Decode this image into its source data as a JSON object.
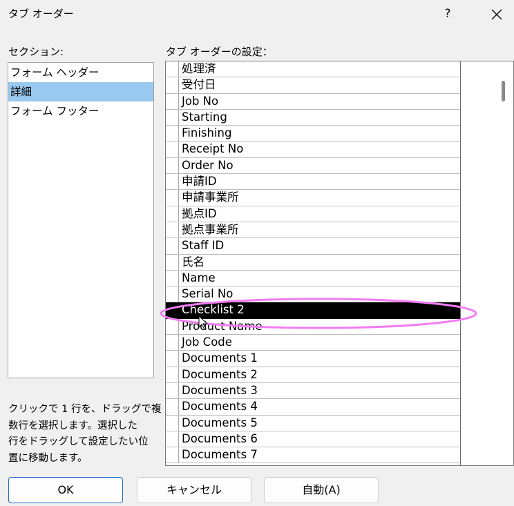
{
  "dialog": {
    "title": "タブ オーダー",
    "help_label": "?"
  },
  "section": {
    "label": "セクション:",
    "items": [
      "フォーム ヘッダー",
      "詳細",
      "フォーム フッター"
    ],
    "selected": "詳細"
  },
  "help_text": [
    "クリックで 1 行を、ドラッグで複",
    "数行を選択します。選択した",
    "行をドラッグして設定したい位",
    "置に移動します。"
  ],
  "tab_order": {
    "label": "タブ オーダーの設定：",
    "items": [
      "処理済",
      "受付日",
      "Job No",
      "Starting",
      "Finishing",
      "Receipt No",
      "Order No",
      "申請ID",
      "申請事業所",
      "拠点ID",
      "拠点事業所",
      "Staff ID",
      "氏名",
      "Name",
      "Serial No",
      "Checklist 2",
      "Product Name",
      "Job Code",
      "Documents 1",
      "Documents 2",
      "Documents 3",
      "Documents 4",
      "Documents 5",
      "Documents 6",
      "Documents 7"
    ],
    "selected": "Checklist 2"
  },
  "buttons": {
    "ok": "OK",
    "cancel": "キャンセル",
    "auto": "自動(A)"
  },
  "colors": {
    "selection_blue": "#99c9ef",
    "selected_row_bg": "#000000",
    "highlight_ellipse": "#f27cf2",
    "default_button_border": "#1e68c4"
  }
}
